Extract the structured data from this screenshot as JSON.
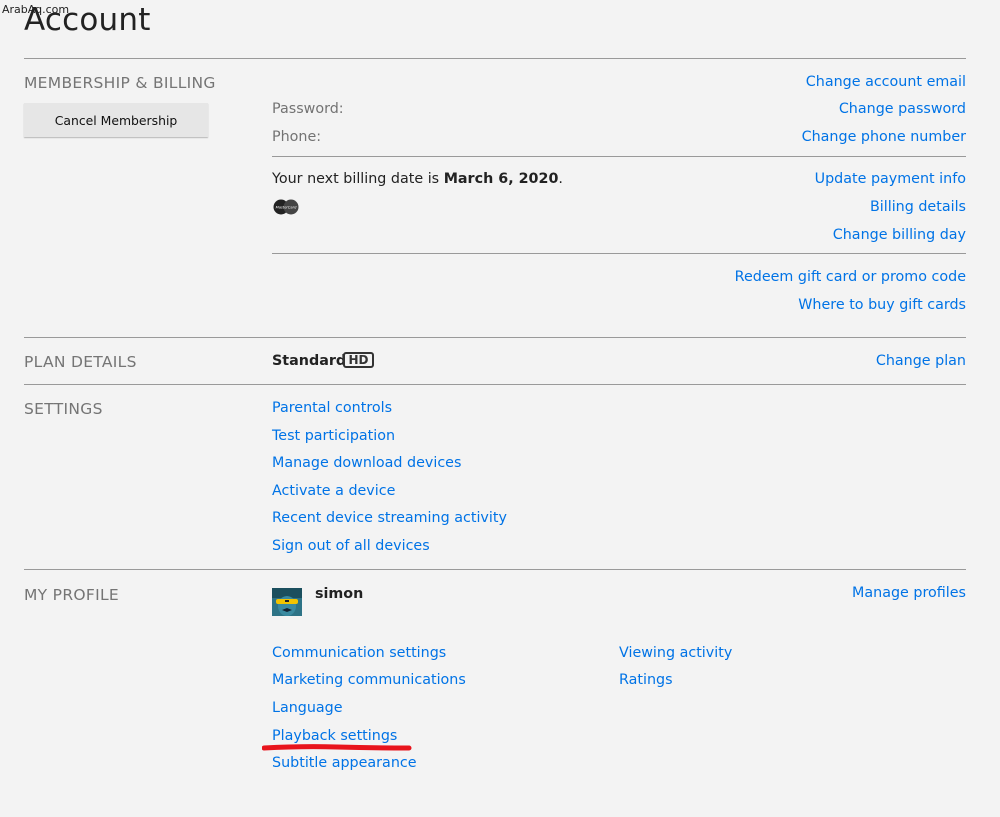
{
  "watermark": "ArabAq.com",
  "title": "Account",
  "membership": {
    "label": "MEMBERSHIP & BILLING",
    "cancel_button": "Cancel Membership",
    "password_label": "Password:",
    "phone_label": "Phone:",
    "change_email": "Change account email",
    "change_password": "Change password",
    "change_phone": "Change phone number",
    "billing_prefix": "Your next billing date is ",
    "billing_date": "March 6, 2020",
    "billing_suffix": ".",
    "card_brand": "MasterCard",
    "update_payment": "Update payment info",
    "billing_details": "Billing details",
    "change_billing_day": "Change billing day",
    "redeem_gift": "Redeem gift card or promo code",
    "where_to_buy": "Where to buy gift cards"
  },
  "plan": {
    "label": "PLAN DETAILS",
    "name": "Standard",
    "badge": "HD",
    "change_plan": "Change plan"
  },
  "settings": {
    "label": "SETTINGS",
    "items": [
      "Parental controls",
      "Test participation",
      "Manage download devices",
      "Activate a device",
      "Recent device streaming activity",
      "Sign out of all devices"
    ]
  },
  "profile": {
    "label": "MY PROFILE",
    "name": "simon",
    "manage_profiles": "Manage profiles",
    "left_links": [
      "Communication settings",
      "Marketing communications",
      "Language",
      "Playback settings",
      "Subtitle appearance"
    ],
    "right_links": [
      "Viewing activity",
      "Ratings"
    ]
  },
  "colors": {
    "link": "#0073e6",
    "background": "#f3f3f3",
    "highlight_mark": "#e8141c"
  }
}
